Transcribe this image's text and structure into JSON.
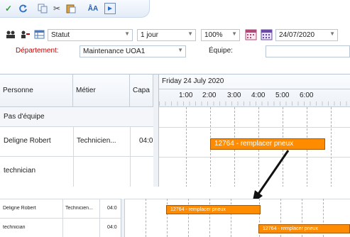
{
  "quick_access": {
    "icons": [
      "check-icon",
      "refresh-icon",
      "copy-icon",
      "cut-icon",
      "paste-icon",
      "find-icon",
      "open-window-icon"
    ],
    "find_label": "ÅA"
  },
  "toolbar": {
    "statut": "Statut",
    "period": "1 jour",
    "zoom": "100%",
    "date": "24/07/2020"
  },
  "filters": {
    "departement_label": "Département:",
    "departement_value": "Maintenance UOA1",
    "equipe_label": "Équipe:",
    "equipe_value": ""
  },
  "grid": {
    "columns": [
      "Personne",
      "Métier",
      "Capa"
    ],
    "date_header": "Friday 24 July 2020",
    "hours": [
      "1:00",
      "2:00",
      "3:00",
      "4:00",
      "5:00",
      "6:00"
    ],
    "rows": [
      {
        "personne": "Pas d'équipe",
        "metier": "",
        "capa": ""
      },
      {
        "personne": "Deligne Robert",
        "metier": "Technicien...",
        "capa": "04:0"
      },
      {
        "personne": "technician",
        "metier": "",
        "capa": ""
      }
    ],
    "task": "12764 - remplacer pneux"
  },
  "zoomed": {
    "rows": [
      {
        "personne": "Deligne Robert",
        "metier": "Technicien...",
        "capa": "04:0",
        "task": "12764 - remplacer pneux"
      },
      {
        "personne": "technician",
        "metier": "",
        "capa": "04:0",
        "task": "12764 - remplacer pneux"
      }
    ]
  },
  "colors": {
    "task_fill": "#ff8c00",
    "task_border": "#a85800",
    "dept_label": "#c00000",
    "arrow": "#111111"
  }
}
